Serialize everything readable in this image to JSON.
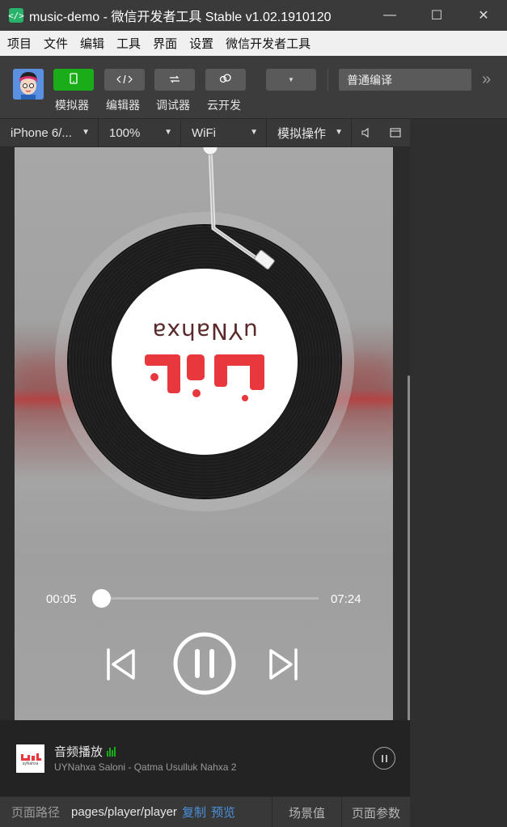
{
  "window": {
    "title": "music-demo - 微信开发者工具 Stable v1.02.1910120",
    "app_icon": "</>",
    "minimize": "—",
    "maximize": "☐",
    "close": "✕"
  },
  "menu": [
    "项目",
    "文件",
    "编辑",
    "工具",
    "界面",
    "设置",
    "微信开发者工具"
  ],
  "toolbar": {
    "tools": [
      {
        "label": "模拟器",
        "icon": "phone-icon",
        "active": true
      },
      {
        "label": "编辑器",
        "icon": "code-icon",
        "active": false
      },
      {
        "label": "调试器",
        "icon": "debug-icon",
        "active": false
      },
      {
        "label": "云开发",
        "icon": "cloud-icon",
        "active": false
      }
    ],
    "compile_mode": "普通编译",
    "more": "»"
  },
  "simulator_bar": {
    "device": "iPhone 6/...",
    "zoom": "100%",
    "network": "WiFi",
    "action": "模拟操作"
  },
  "player": {
    "disc_label_text": "uYNahxa",
    "current_time": "00:05",
    "total_time": "07:24",
    "progress": 0.04
  },
  "mini_player": {
    "title": "音频播放",
    "subtitle": "UYNahxa Saloni - Qatma Usulluk Nahxa 2",
    "cover_text": "uyNahxa"
  },
  "status": {
    "path_label": "页面路径",
    "path_value": "pages/player/player",
    "copy": "复制",
    "preview": "预览",
    "scene": "场景值",
    "page_params": "页面参数"
  },
  "colors": {
    "accent_green": "#1aad19",
    "link_blue": "#4a8fdb",
    "label_red": "#e8383d"
  }
}
